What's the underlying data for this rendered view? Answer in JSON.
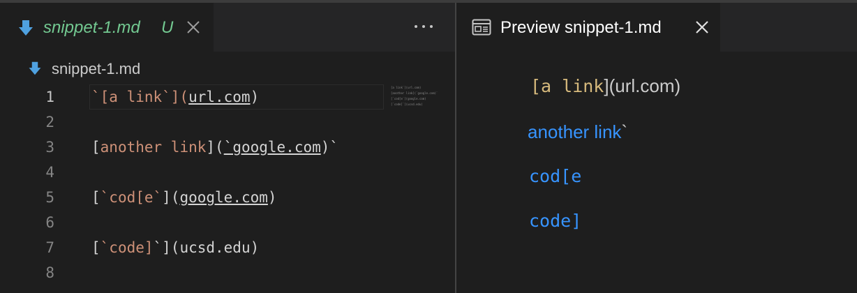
{
  "editor": {
    "tab": {
      "label": "snippet-1.md",
      "status": "U"
    },
    "breadcrumb": "snippet-1.md",
    "lines": [
      {
        "n": "1",
        "parts": [
          {
            "t": "`[a link`](",
            "c": "lt"
          },
          {
            "t": "url.com",
            "c": "u"
          },
          {
            "t": ")",
            "c": ""
          }
        ]
      },
      {
        "n": "2",
        "parts": []
      },
      {
        "n": "3",
        "parts": [
          {
            "t": "[",
            "c": ""
          },
          {
            "t": "another link",
            "c": "lt"
          },
          {
            "t": "](",
            "c": ""
          },
          {
            "t": "`google.com",
            "c": "u"
          },
          {
            "t": ")`",
            "c": ""
          }
        ]
      },
      {
        "n": "4",
        "parts": []
      },
      {
        "n": "5",
        "parts": [
          {
            "t": "[",
            "c": ""
          },
          {
            "t": "`cod[e`",
            "c": "lt"
          },
          {
            "t": "](",
            "c": ""
          },
          {
            "t": "google.com",
            "c": "u"
          },
          {
            "t": ")",
            "c": ""
          }
        ]
      },
      {
        "n": "6",
        "parts": []
      },
      {
        "n": "7",
        "parts": [
          {
            "t": "[",
            "c": ""
          },
          {
            "t": "`code]",
            "c": "lt"
          },
          {
            "t": "`](ucsd.edu)",
            "c": ""
          }
        ]
      },
      {
        "n": "8",
        "parts": []
      }
    ],
    "minimap": [
      "[a link`](url.com)",
      "[another link](`google.com)`",
      "[`cod[e`](google.com)",
      "[`code]`](ucsd.edu)"
    ]
  },
  "preview": {
    "tab": {
      "label": "Preview snippet-1.md"
    },
    "line1": {
      "code": "[a link",
      "rest": "](url.com)"
    },
    "line2": {
      "link": "another link",
      "rest": "`"
    },
    "line3": {
      "link": "cod[e"
    },
    "line4": {
      "link": "code]"
    }
  },
  "colors": {
    "accent_link": "#3794ff",
    "tab_untracked": "#73c991",
    "markdown_link_text": "#ce9178",
    "code_span": "#d7ba7d"
  }
}
